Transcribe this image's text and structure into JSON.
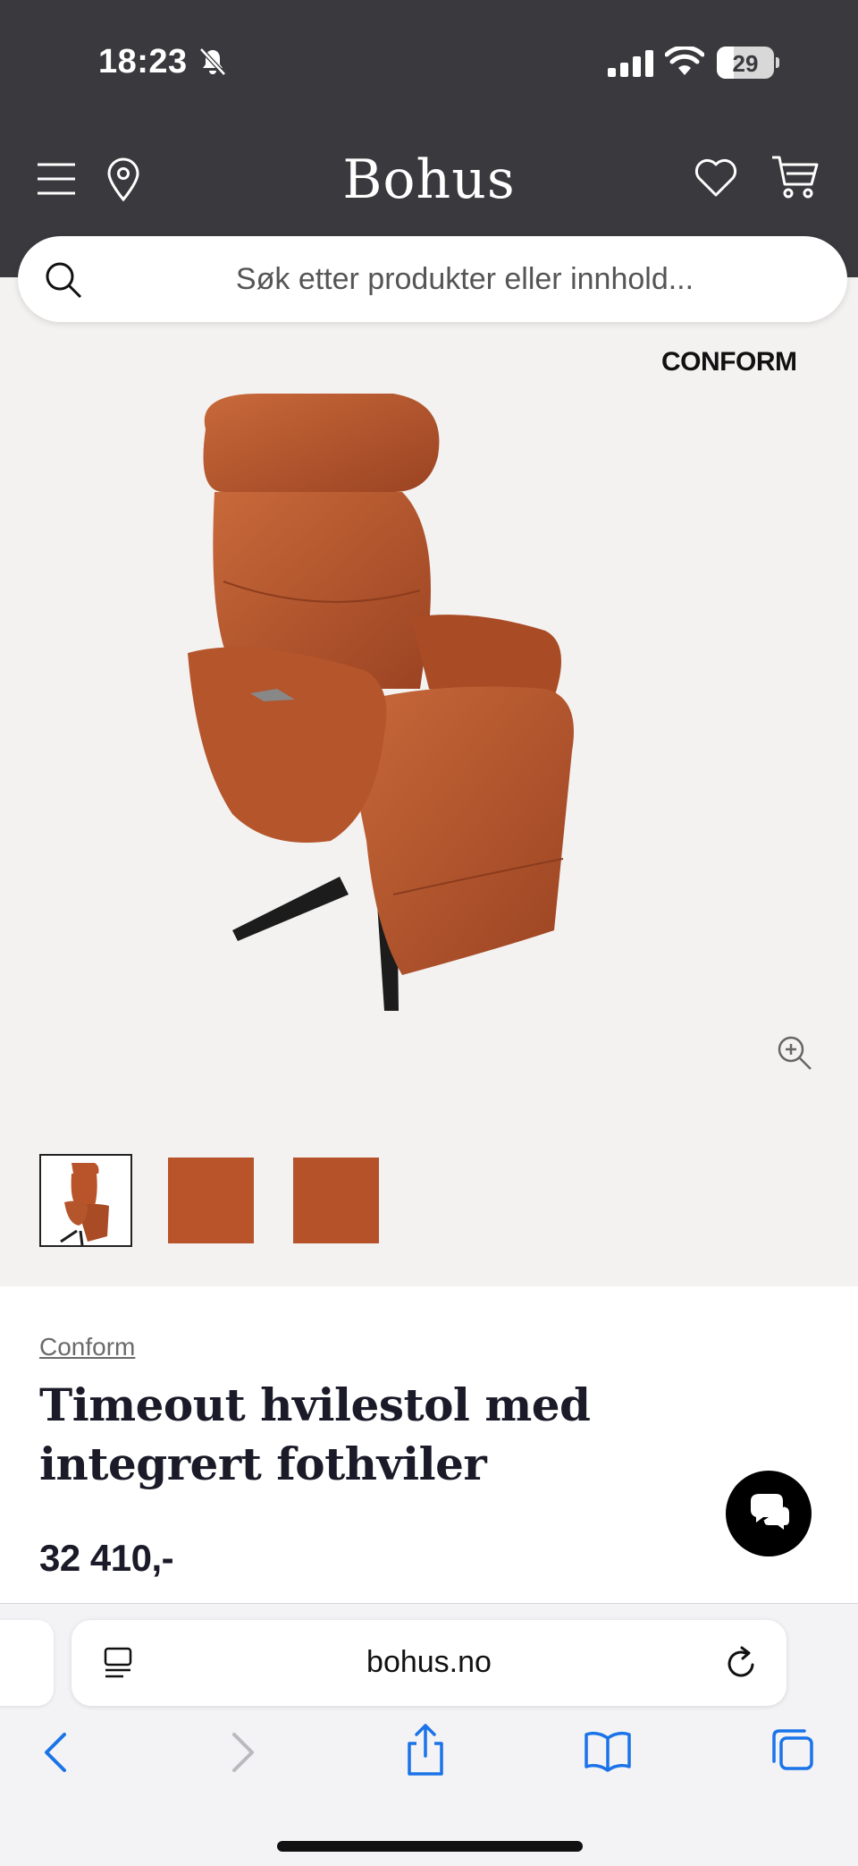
{
  "status_bar": {
    "time": "18:23",
    "battery": "29",
    "battery_level": 0.29,
    "icons": [
      "bell-slash-icon",
      "cellular-signal-icon",
      "wifi-icon",
      "battery-icon"
    ]
  },
  "header": {
    "brand": "Bohus",
    "icons": [
      "menu-icon",
      "location-pin-icon",
      "heart-icon",
      "cart-icon"
    ]
  },
  "search": {
    "placeholder": "Søk etter produkter eller innhold..."
  },
  "gallery": {
    "brand_logo": "CONFORM",
    "thumbnails": [
      "chair-photo",
      "leather-swatch",
      "leather-swatch"
    ],
    "selected_thumbnail": 1,
    "colors": {
      "leather": "#b8532a",
      "background": "#f4f2f1"
    }
  },
  "product": {
    "brand": "Conform",
    "title": "Timeout hvilestol med integrert fothviler",
    "price": "32 410,-"
  },
  "browser": {
    "url": "bohus.no",
    "toolbar_icons": [
      "back-icon",
      "forward-icon",
      "share-icon",
      "bookmarks-icon",
      "tabs-icon"
    ]
  },
  "colors": {
    "header_bg": "#3a3a3e",
    "text_dark": "#1a1a28",
    "ios_blue": "#1a73e8"
  }
}
